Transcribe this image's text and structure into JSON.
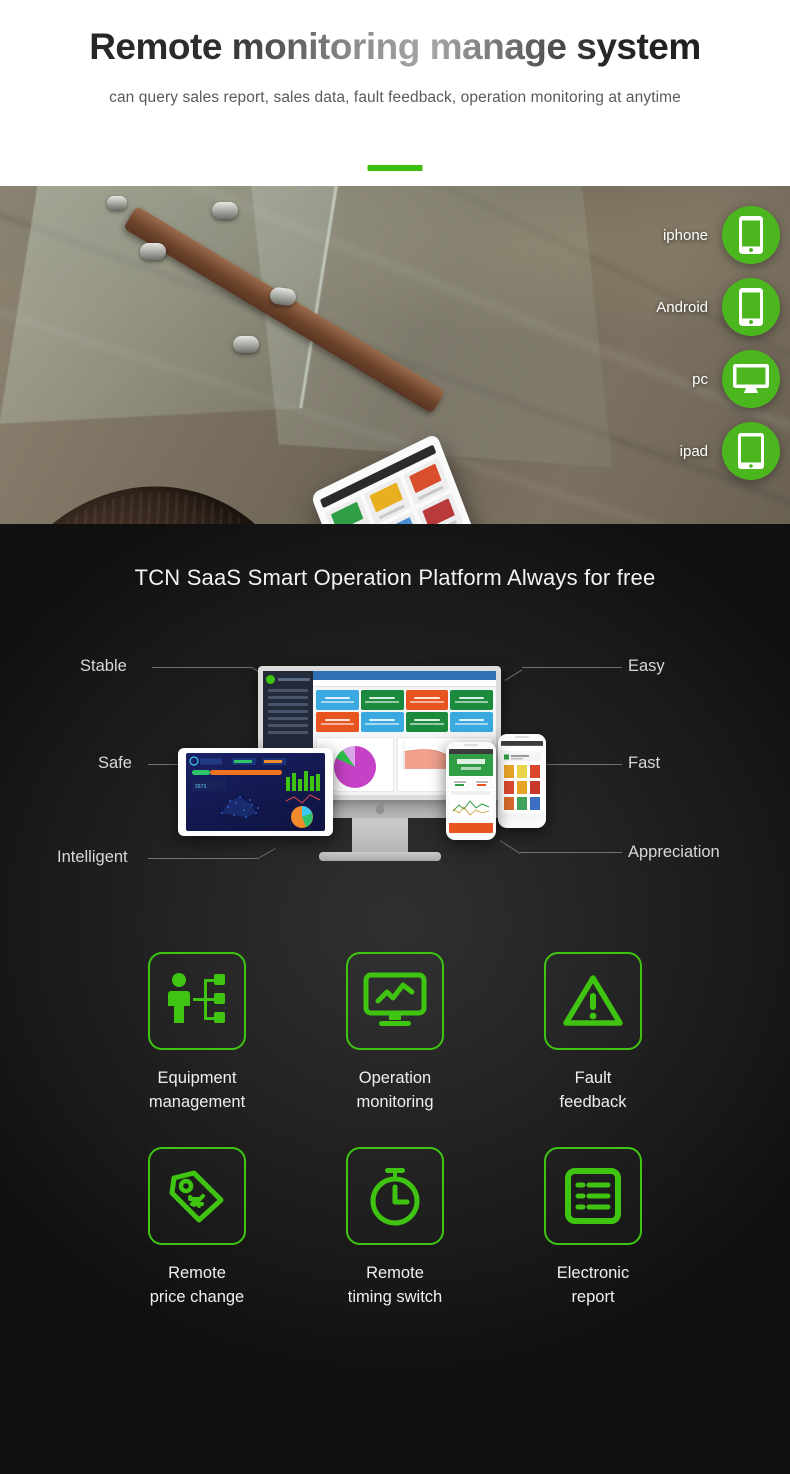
{
  "hero": {
    "title": "Remote monitoring manage system",
    "subtitle": "can query sales report,  sales data,  fault feedback,\noperation monitoring at anytime",
    "accent_color": "#3dc00d"
  },
  "photo": {
    "alt": "woman-using-tablet-photo",
    "platform_badge_color": "#4cb61f",
    "devices": [
      {
        "label": "iphone",
        "icon": "mobile-phone-icon"
      },
      {
        "label": "Android",
        "icon": "mobile-phone-icon"
      },
      {
        "label": "pc",
        "icon": "desktop-monitor-icon"
      },
      {
        "label": "ipad",
        "icon": "tablet-icon"
      }
    ]
  },
  "platform": {
    "heading": "TCN SaaS Smart Operation Platform  Always for free",
    "left_labels": [
      "Stable",
      "Safe",
      "Intelligent"
    ],
    "right_labels": [
      "Easy",
      "Fast",
      "Appreciation"
    ],
    "dashboard": {
      "card_colors": [
        "#3aa9e0",
        "#1b8a3c",
        "#e8541f",
        "#1b8a3c",
        "#e8541f",
        "#3aa9e0",
        "#1b8a3c",
        "#3aa9e0"
      ],
      "pie_color": "#c541c5",
      "area_color": "#f0a08d"
    }
  },
  "features": {
    "accent_color": "#3fc412",
    "rows": [
      [
        {
          "label": "Equipment\nmanagement",
          "icon": "org-chart-person-icon"
        },
        {
          "label": "Operation\nmonitoring",
          "icon": "monitor-chart-icon"
        },
        {
          "label": "Fault\nfeedback",
          "icon": "warning-triangle-icon"
        }
      ],
      [
        {
          "label": "Remote\nprice change",
          "icon": "price-tag-icon"
        },
        {
          "label": "Remote\ntiming switch",
          "icon": "stopwatch-icon"
        },
        {
          "label": "Electronic\nreport",
          "icon": "list-report-icon"
        }
      ]
    ]
  }
}
